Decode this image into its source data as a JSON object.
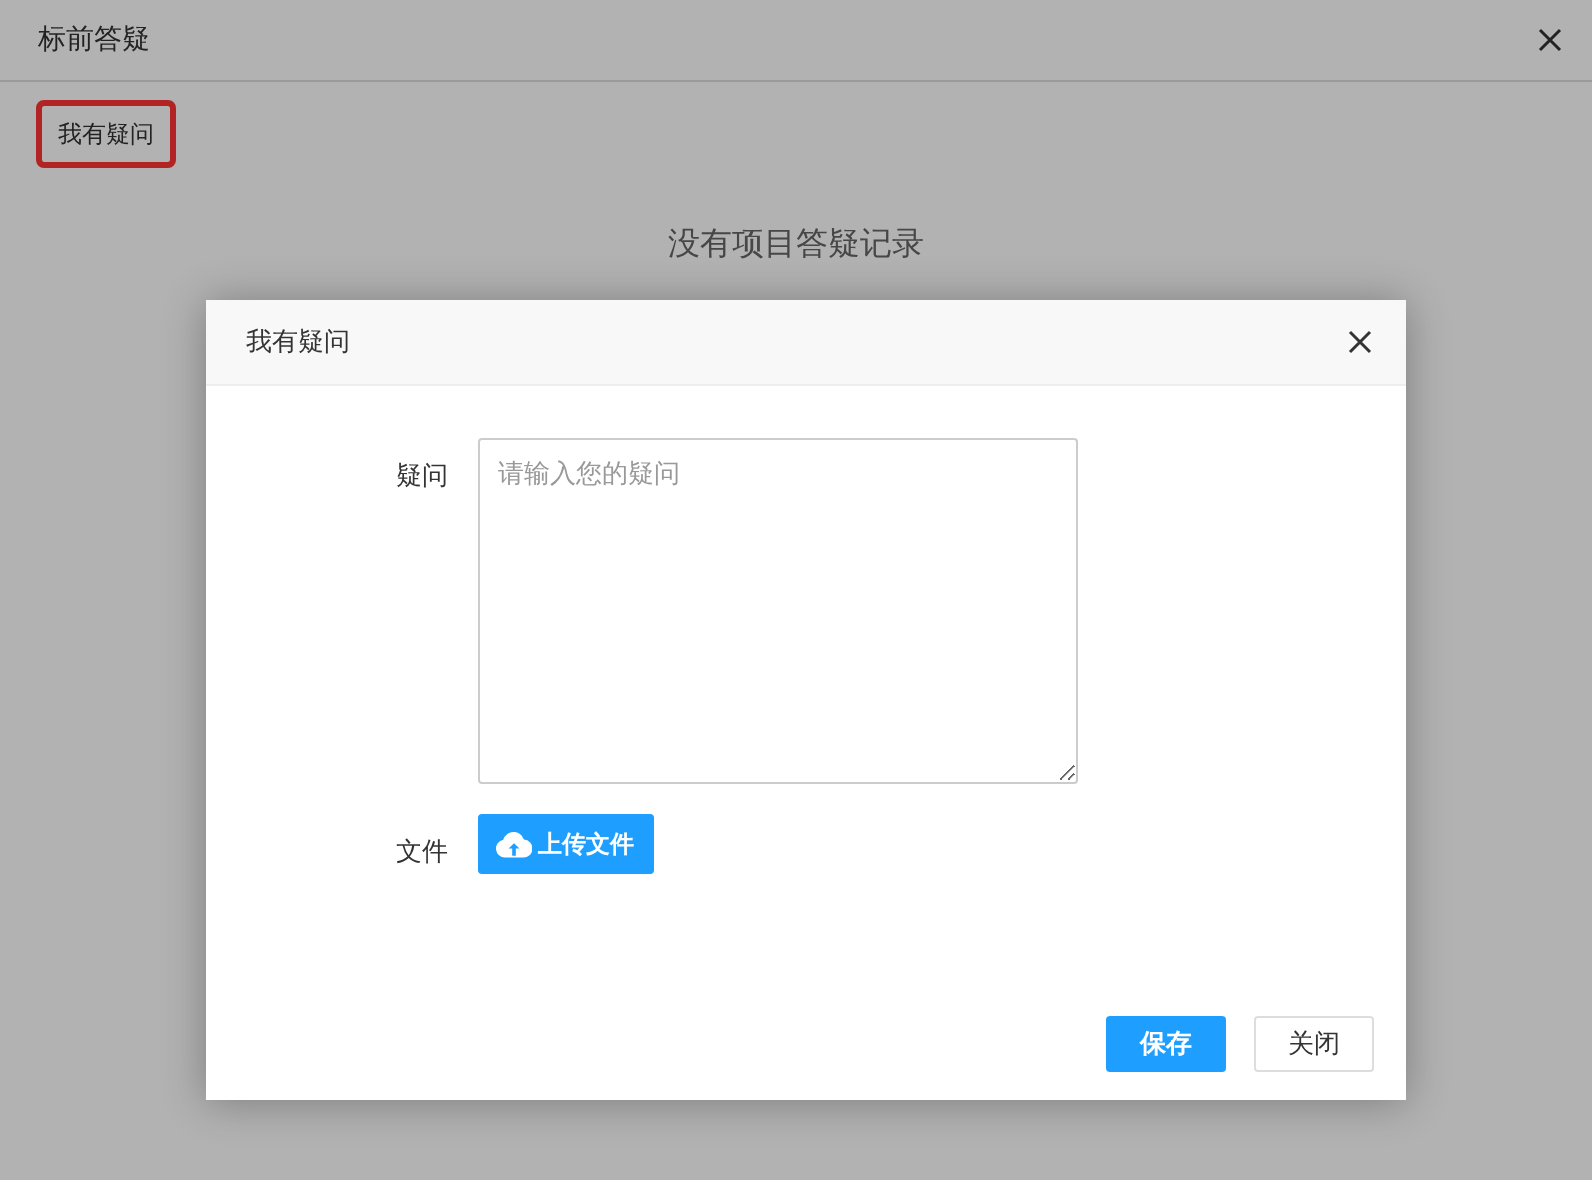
{
  "window": {
    "title": "标前答疑"
  },
  "ask_button": {
    "label": "我有疑问",
    "highlighted": true
  },
  "empty_message": "没有项目答疑记录",
  "dialog": {
    "title": "我有疑问",
    "question": {
      "label": "疑问",
      "placeholder": "请输入您的疑问"
    },
    "file": {
      "label": "文件",
      "button": "上传文件"
    },
    "buttons": [
      {
        "label": "保存",
        "kind": "primary"
      },
      {
        "label": "关闭",
        "kind": "default"
      }
    ]
  }
}
